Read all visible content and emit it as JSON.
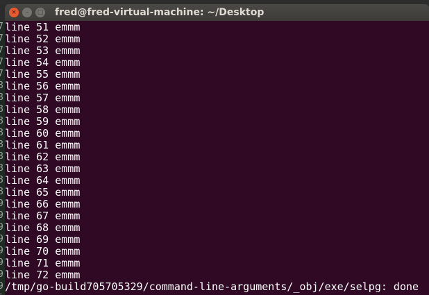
{
  "window": {
    "title": "fred@fred-virtual-machine: ~/Desktop"
  },
  "controls": {
    "close": "×",
    "minimize": "–",
    "maximize": "□"
  },
  "background_gutter_digits": [
    "7",
    "7",
    "7",
    "7",
    "7",
    "8",
    "8",
    "8",
    "8",
    "8",
    "8",
    "8",
    "8",
    "8",
    "8",
    "9",
    "9",
    "9",
    "9",
    "9",
    "9",
    "9",
    "9",
    "0"
  ],
  "terminal": {
    "lines": [
      "line 51 emmm",
      "line 52 emmm",
      "line 53 emmm",
      "line 54 emmm",
      "line 55 emmm",
      "line 56 emmm",
      "line 57 emmm",
      "line 58 emmm",
      "line 59 emmm",
      "line 60 emmm",
      "line 61 emmm",
      "line 62 emmm",
      "line 63 emmm",
      "line 64 emmm",
      "line 65 emmm",
      "line 66 emmm",
      "line 67 emmm",
      "line 68 emmm",
      "line 69 emmm",
      "line 70 emmm",
      "line 71 emmm",
      "line 72 emmm",
      "/tmp/go-build705705329/command-line-arguments/_obj/exe/selpg: done"
    ]
  },
  "colors": {
    "terminal_bg": "#300a24",
    "titlebar": "#3c3b37",
    "close_button": "#e95b2f"
  }
}
